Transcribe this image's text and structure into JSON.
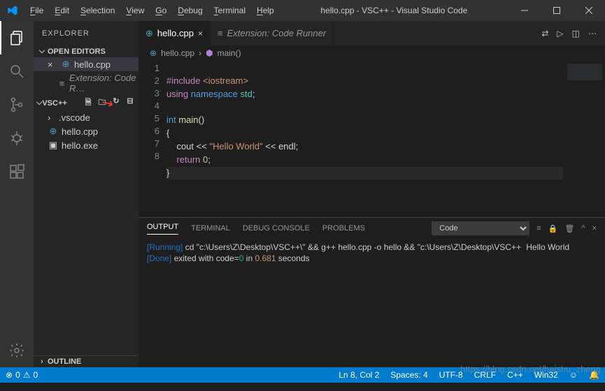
{
  "titlebar": {
    "menus": [
      "File",
      "Edit",
      "Selection",
      "View",
      "Go",
      "Debug",
      "Terminal",
      "Help"
    ],
    "title": "hello.cpp - VSC++ - Visual Studio Code"
  },
  "sidebar": {
    "title": "EXPLORER",
    "open_editors": "OPEN EDITORS",
    "editors": [
      {
        "label": "hello.cpp",
        "icon": "cpp",
        "close": true
      },
      {
        "label": "Extension: Code R…",
        "icon": "ext",
        "close": false
      }
    ],
    "workspace": "VSC++",
    "tree": [
      {
        "label": ".vscode",
        "type": "folder"
      },
      {
        "label": "hello.cpp",
        "type": "cpp"
      },
      {
        "label": "hello.exe",
        "type": "exe"
      }
    ],
    "outline": "OUTLINE"
  },
  "tabs": [
    {
      "label": "hello.cpp",
      "icon": "cpp",
      "active": true
    },
    {
      "label": "Extension: Code Runner",
      "icon": "ext",
      "active": false
    }
  ],
  "breadcrumb": {
    "file": "hello.cpp",
    "symbol": "main()"
  },
  "code": {
    "lines": [
      "1",
      "2",
      "3",
      "4",
      "5",
      "6",
      "7",
      "8"
    ],
    "l1_include": "#include",
    "l1_iostream": " <iostream>",
    "l2_using": "using",
    "l2_namespace": " namespace",
    "l2_std": " std",
    "l2_semi": ";",
    "l4_int": "int",
    "l4_main": " main",
    "l4_paren": "()",
    "l5": "{",
    "l6_cout": "    cout",
    "l6_op1": " << ",
    "l6_str": "\"Hello World\"",
    "l6_op2": " << ",
    "l6_endl": "endl",
    "l6_semi": ";",
    "l7_return": "    return",
    "l7_zero": " 0",
    "l7_semi": ";",
    "l8": "}"
  },
  "panel": {
    "tabs": [
      "OUTPUT",
      "TERMINAL",
      "DEBUG CONSOLE",
      "PROBLEMS"
    ],
    "select": "Code",
    "running_label": "[Running]",
    "running_cmd": " cd \"c:\\Users\\Z\\Desktop\\VSC++\\\" && g++ hello.cpp -o hello && \"c:\\Users\\Z\\Desktop\\VSC++",
    "hello": "Hello World",
    "done_label": "[Done]",
    "done_text1": " exited with code=",
    "done_code": "0",
    "done_text2": " in ",
    "done_time": "0.681",
    "done_text3": " seconds"
  },
  "status": {
    "errors": "0",
    "warnings": "0",
    "ln": "Ln 8, Col 2",
    "spaces": "Spaces: 4",
    "enc": "UTF-8",
    "eol": "CRLF",
    "lang": "C++",
    "target": "Win32",
    "bell": "🔔"
  },
  "watermark": "https://blog.csdn.net/haishu_zheng"
}
